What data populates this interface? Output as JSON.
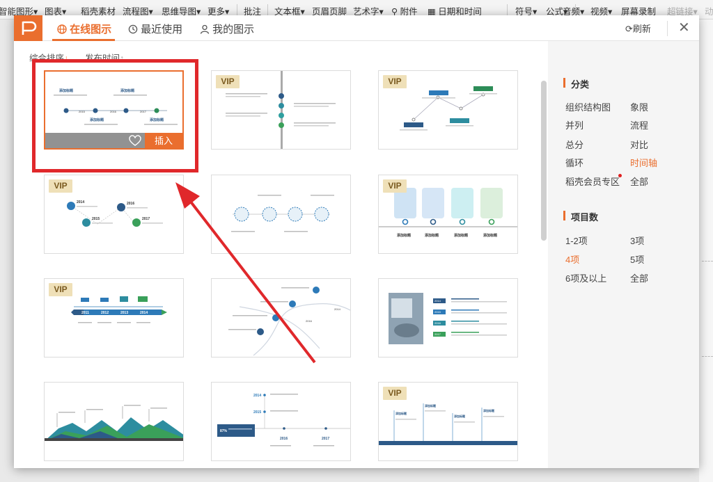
{
  "toolbar": {
    "items": [
      {
        "label": "智能图形",
        "arrow": true
      },
      {
        "label": "图表",
        "arrow": true
      },
      {
        "label": "稻壳素材"
      },
      {
        "label": "流程图",
        "arrow": true
      },
      {
        "label": "思维导图",
        "arrow": true
      },
      {
        "label": "更多",
        "arrow": true
      },
      {
        "label": "批注"
      },
      {
        "label": "文本框",
        "arrow": true
      },
      {
        "label": "页眉页脚"
      },
      {
        "label": "艺术字",
        "arrow": true
      },
      {
        "label": "附件"
      },
      {
        "label": "日期和时间"
      },
      {
        "label": "符号",
        "arrow": true
      },
      {
        "label": "公式",
        "arrow": true
      },
      {
        "label": "音频",
        "arrow": true
      },
      {
        "label": "视频",
        "arrow": true
      },
      {
        "label": "屏幕录制"
      },
      {
        "label": "超链接",
        "arrow": true
      },
      {
        "label": "动"
      }
    ]
  },
  "dialog": {
    "tabs": [
      {
        "label": "在线图示",
        "icon": "globe-icon",
        "active": true
      },
      {
        "label": "最近使用",
        "icon": "history-icon"
      },
      {
        "label": "我的图示",
        "icon": "user-icon"
      }
    ],
    "refresh_label": "刷新",
    "close_label": "✕",
    "sort": {
      "option1": "综合排序",
      "option1_arrow": "↓",
      "option2": "发布时间",
      "option2_arrow": "↑"
    },
    "hover_card": {
      "insert_label": "插入"
    },
    "vip_label": "VIP",
    "vip_cards": [
      1,
      2,
      3,
      5,
      6,
      11
    ],
    "accent_color": "#ea6e2e",
    "annotation_color": "#e0282b"
  },
  "thumbs": {
    "t1": {
      "top_a": "添加标题",
      "top_b": "添加标题",
      "bottom_a": "添加标题",
      "bottom_b": "添加标题",
      "y1": "2015",
      "y2": "2016",
      "y3": "2017"
    },
    "t5": {
      "y1": "2014",
      "y2": "2016",
      "y3": "2015",
      "y4": "2017"
    },
    "t7": {
      "bottom": [
        "添加标题",
        "添加标题",
        "添加标题",
        "添加标题"
      ]
    },
    "t8": {
      "years": [
        "2011",
        "2012",
        "2013",
        "2014"
      ]
    },
    "t9": {
      "d1": "2014",
      "d2": "2016"
    },
    "t10": {
      "years": [
        "2014",
        "2015",
        "2016",
        "2017"
      ]
    },
    "t11": {
      "labels": [
        "添加标题",
        "添加标题",
        "添加标题",
        "添加标题"
      ]
    },
    "t12": {
      "y1": "2014",
      "y2": "2015",
      "y3": "2016",
      "y4": "2017",
      "pct": "87%"
    }
  },
  "sidebar": {
    "category_title": "分类",
    "categories": [
      {
        "label": "组织结构图"
      },
      {
        "label": "象限"
      },
      {
        "label": "并列"
      },
      {
        "label": "流程"
      },
      {
        "label": "总分"
      },
      {
        "label": "对比"
      },
      {
        "label": "循环"
      },
      {
        "label": "时间轴",
        "active": true
      },
      {
        "label": "稻壳会员专区"
      },
      {
        "label": "全部"
      }
    ],
    "count_title": "项目数",
    "counts": [
      {
        "label": "1-2项"
      },
      {
        "label": "3项"
      },
      {
        "label": "4项",
        "active": true
      },
      {
        "label": "5项"
      },
      {
        "label": "6项及以上"
      },
      {
        "label": "全部"
      }
    ]
  }
}
